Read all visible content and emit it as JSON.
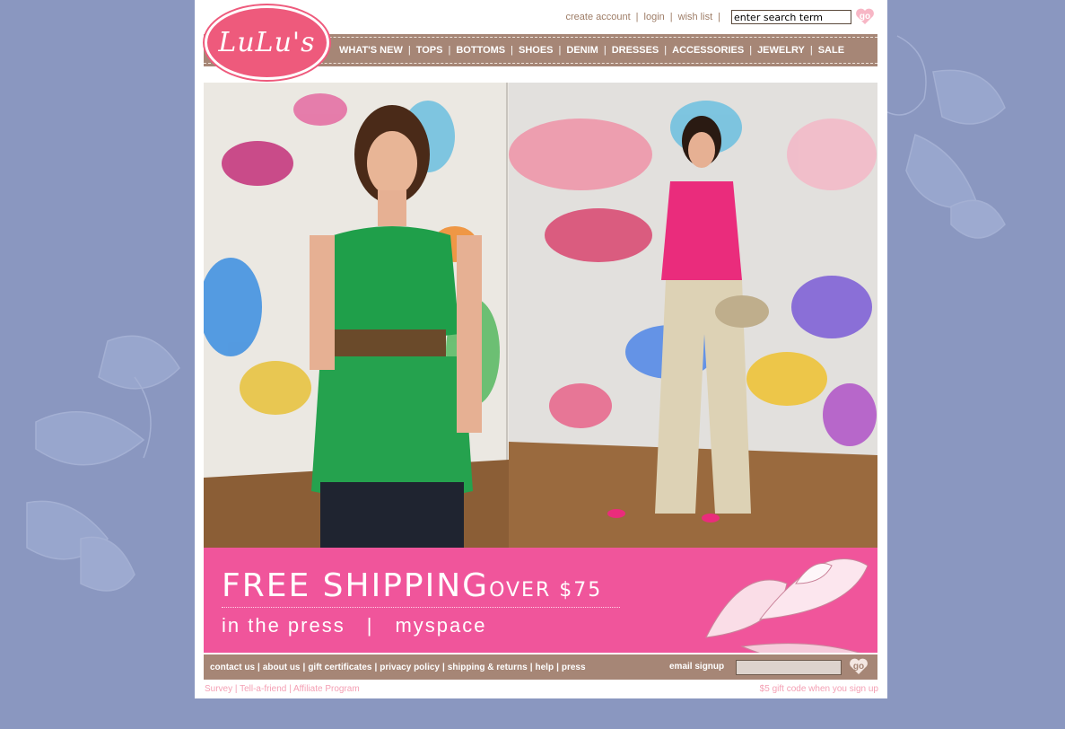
{
  "brand": {
    "name": "LuLu's"
  },
  "utility_nav": {
    "create_account": "create account",
    "login": "login",
    "wish_list": "wish list",
    "search_placeholder": "enter search term",
    "go_label": "go"
  },
  "main_nav": [
    "WHAT'S NEW",
    "TOPS",
    "BOTTOMS",
    "SHOES",
    "DENIM",
    "DRESSES",
    "ACCESSORIES",
    "JEWELRY",
    "SALE"
  ],
  "promo": {
    "headline": "FREE SHIPPING",
    "headline_suffix": "OVER $75",
    "link_press": "in the press",
    "link_sep": "|",
    "link_myspace": "myspace"
  },
  "footer": {
    "links": [
      "contact us",
      "about us",
      "gift certificates",
      "privacy policy",
      "shipping & returns",
      "help",
      "press"
    ],
    "email_label": "email signup",
    "go_label": "go"
  },
  "subfooter": {
    "left": "Survey | Tell-a-friend | Affiliate Program",
    "right": "$5 gift code when you sign up"
  },
  "colors": {
    "background": "#8a97c0",
    "brand_pink": "#ee5a7c",
    "nav_brown": "#a68676",
    "promo_pink": "#f0559b",
    "subfooter_pink": "#f4a0b4"
  }
}
